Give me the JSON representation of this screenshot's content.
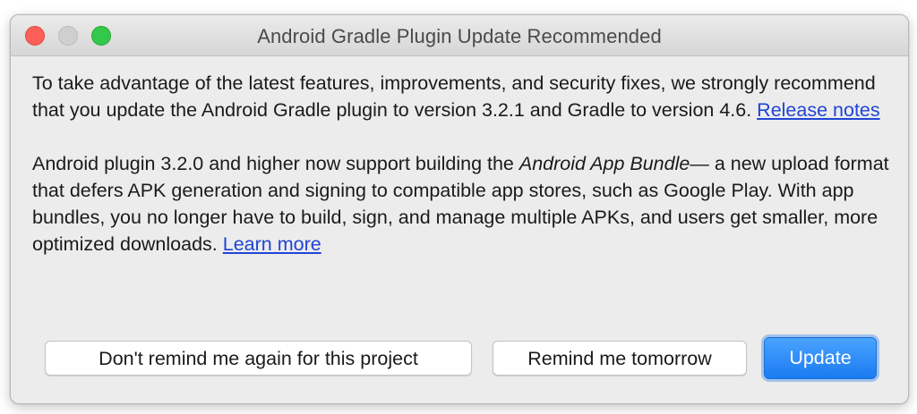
{
  "window": {
    "title": "Android Gradle Plugin Update Recommended"
  },
  "message": {
    "para1_text": "To take advantage of the latest features, improvements, and security fixes, we strongly recommend that you update the Android Gradle plugin to version 3.2.1 and Gradle to version 4.6. ",
    "para1_link": "Release notes",
    "para2_text_a": "Android plugin 3.2.0 and higher now support building the ",
    "para2_emphasis": "Android App Bundle",
    "para2_text_b": "— a new upload format that defers APK generation and signing to compatible app stores, such as Google Play. With app bundles, you no longer have to build, sign, and manage multiple APKs, and users get smaller, more optimized downloads. ",
    "para2_link": "Learn more"
  },
  "buttons": {
    "dont_remind": "Don't remind me again for this project",
    "remind_tomorrow": "Remind me tomorrow",
    "update": "Update"
  },
  "colors": {
    "link": "#1f44d6",
    "primary_button": "#1a7bf2",
    "close": "#fc5f57",
    "zoom": "#34c84a"
  }
}
